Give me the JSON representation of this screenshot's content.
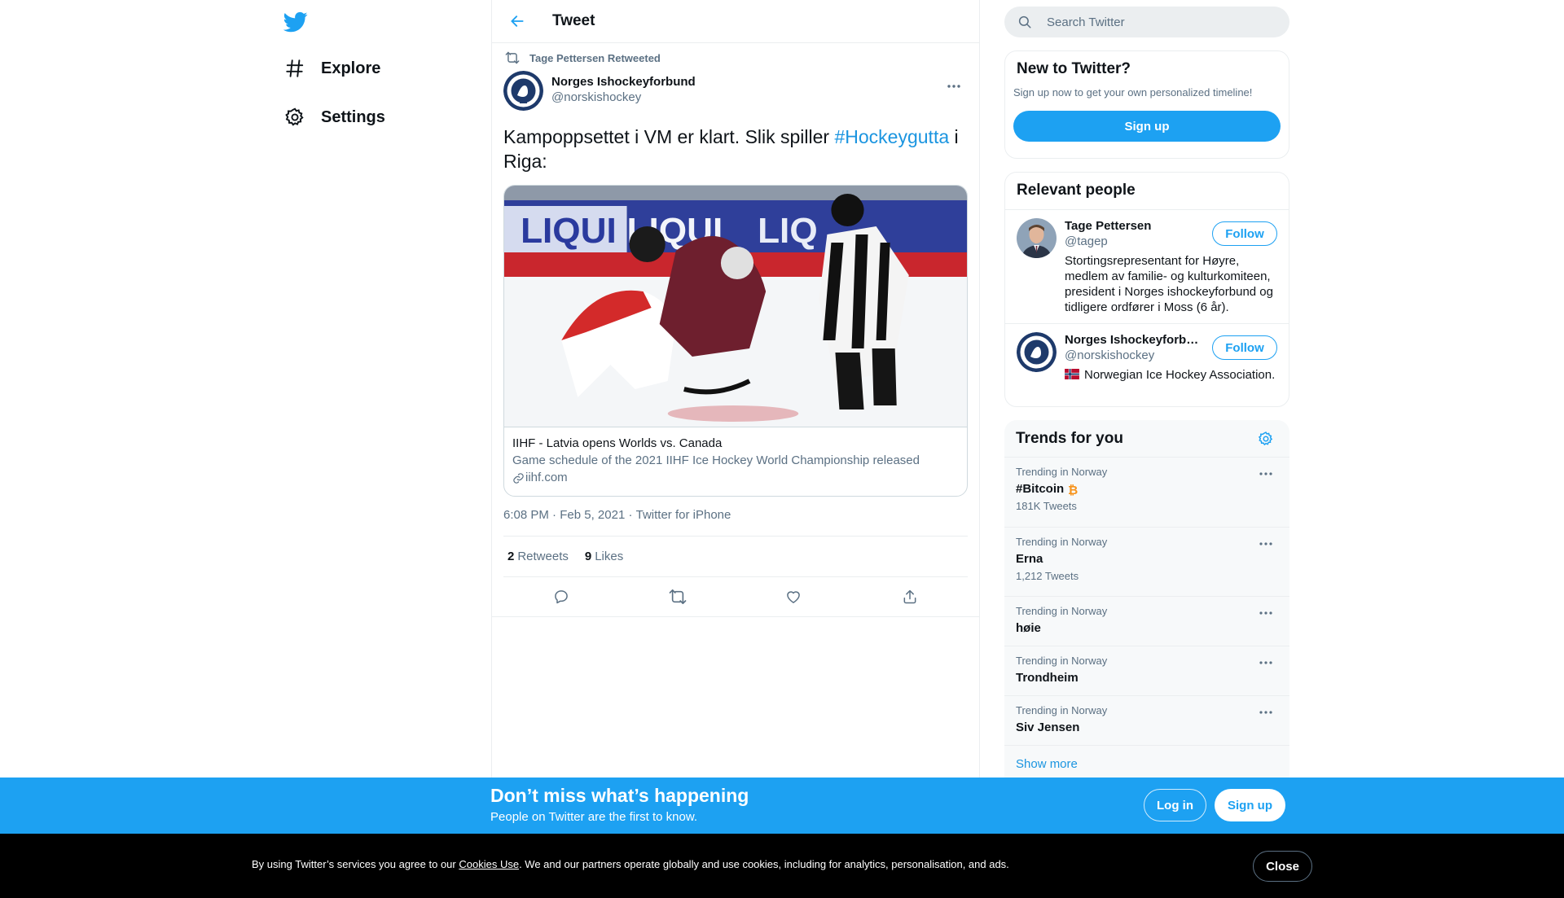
{
  "nav": {
    "logo": "twitter-bird-icon",
    "items": [
      {
        "label": "Explore",
        "icon": "hashtag-icon"
      },
      {
        "label": "Settings",
        "icon": "gear-icon"
      }
    ]
  },
  "main": {
    "header_title": "Tweet",
    "tweet": {
      "retweeted_by": "Tage Pettersen Retweeted",
      "author_name": "Norges Ishockeyforbund",
      "author_handle": "@norskishockey",
      "text_before": "Kampoppsettet i VM er klart. Slik spiller ",
      "hashtag": "#Hockeygutta",
      "text_after": " i Riga:",
      "card": {
        "title": "IIHF - Latvia opens Worlds vs. Canada",
        "description": "Game schedule of the 2021 IIHF Ice Hockey World Championship released",
        "domain": "iihf.com"
      },
      "time": "6:08 PM",
      "date": "Feb 5, 2021",
      "source": "Twitter for iPhone",
      "separator": "·",
      "retweets_count": "2",
      "retweets_label": "Retweets",
      "likes_count": "9",
      "likes_label": "Likes"
    }
  },
  "sidebar": {
    "search_placeholder": "Search Twitter",
    "new_to_twitter": {
      "title": "New to Twitter?",
      "subtitle": "Sign up now to get your own personalized timeline!",
      "button": "Sign up"
    },
    "relevant_people": {
      "title": "Relevant people",
      "people": [
        {
          "name": "Tage Pettersen",
          "handle": "@tagep",
          "bio": "Stortingsrepresentant for Høyre, medlem av familie- og kulturkomiteen, president i Norges ishockeyforbund og tidligere ordfører i Moss (6 år).",
          "button": "Follow"
        },
        {
          "name": "Norges Ishockeyforbund",
          "handle": "@norskishockey",
          "bio": "Norwegian Ice Hockey Association.",
          "button": "Follow"
        }
      ]
    },
    "trends": {
      "title": "Trends for you",
      "items": [
        {
          "context": "Trending in Norway",
          "name": "#Bitcoin",
          "count": "181K Tweets"
        },
        {
          "context": "Trending in Norway",
          "name": "Erna",
          "count": "1,212 Tweets"
        },
        {
          "context": "Trending in Norway",
          "name": "høie",
          "count": ""
        },
        {
          "context": "Trending in Norway",
          "name": "Trondheim",
          "count": ""
        },
        {
          "context": "Trending in Norway",
          "name": "Siv Jensen",
          "count": ""
        }
      ],
      "show_more": "Show more"
    }
  },
  "signup_banner": {
    "title": "Don’t miss what’s happening",
    "subtitle": "People on Twitter are the first to know.",
    "login": "Log in",
    "signup": "Sign up"
  },
  "cookie_bar": {
    "text_before": "By using Twitter’s services you agree to our ",
    "link": "Cookies Use",
    "text_after": ". We and our partners operate globally and use cookies, including for analytics, personalisation, and ads.",
    "close": "Close"
  },
  "colors": {
    "accent": "#1da1f2",
    "link": "#1b95e0",
    "muted": "#5b7083",
    "bitcoin": "#f7931a"
  }
}
